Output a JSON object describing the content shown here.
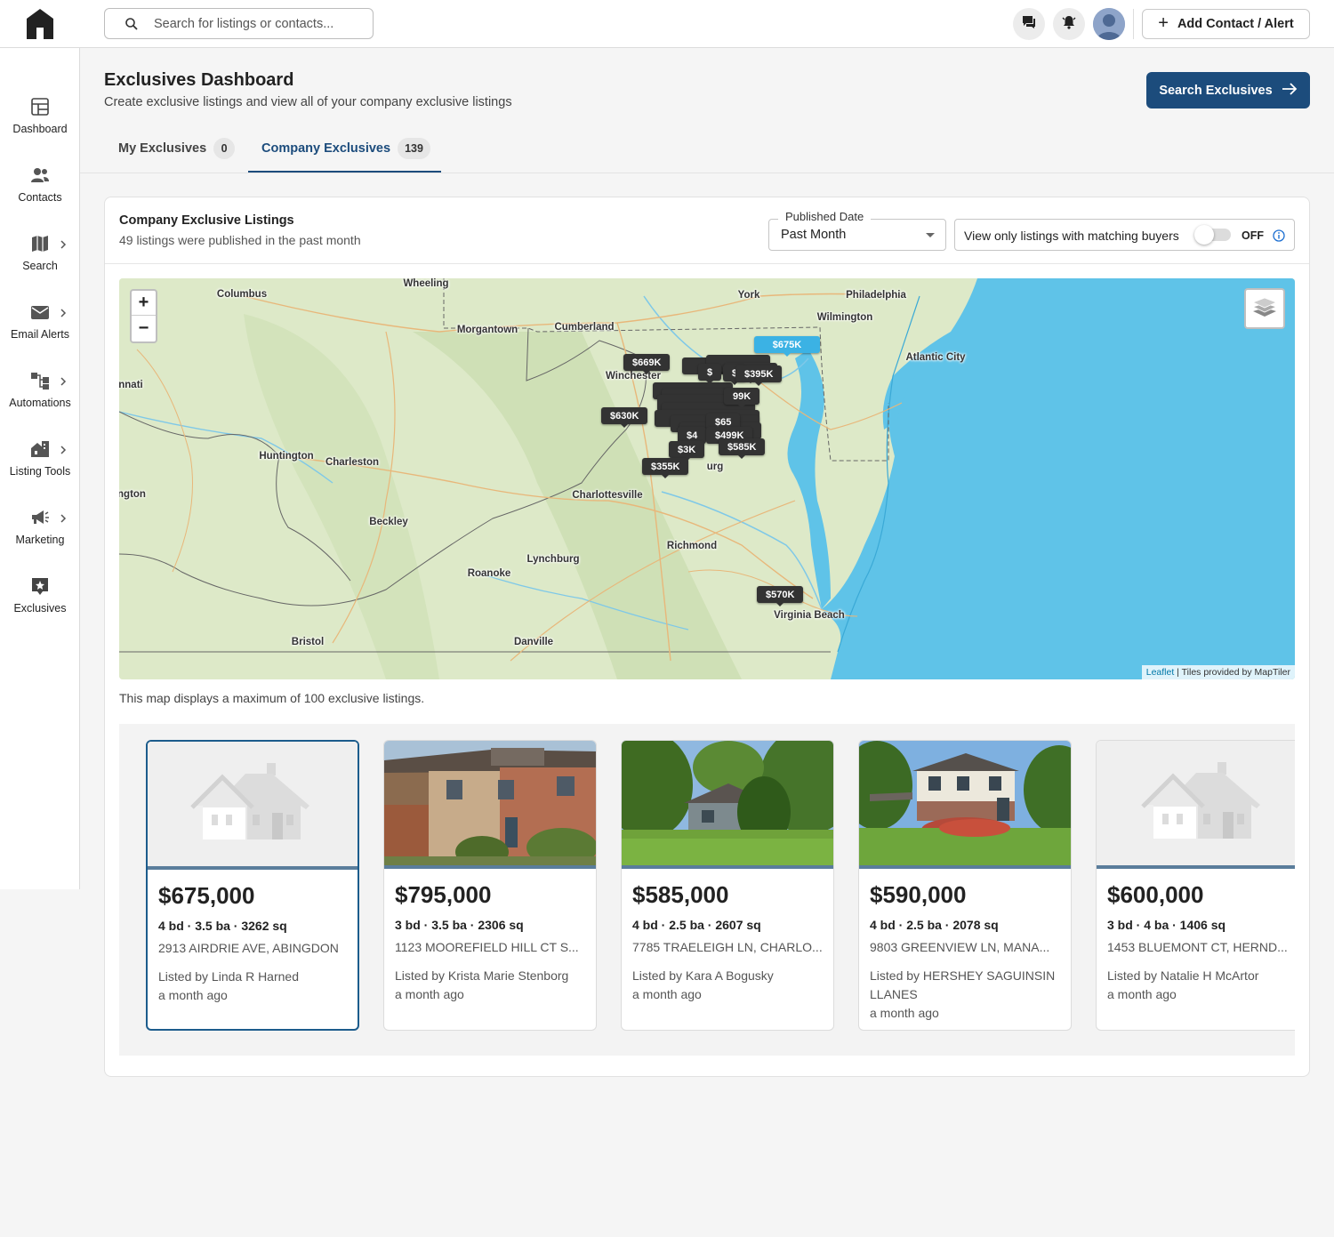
{
  "header": {
    "search_placeholder": "Search for listings or contacts...",
    "add_button": "Add Contact / Alert"
  },
  "sidebar": {
    "items": [
      {
        "label": "Dashboard",
        "icon": "dashboard-icon"
      },
      {
        "label": "Contacts",
        "icon": "contacts-icon"
      },
      {
        "label": "Search",
        "icon": "map-icon"
      },
      {
        "label": "Email Alerts",
        "icon": "mail-icon"
      },
      {
        "label": "Automations",
        "icon": "automations-icon"
      },
      {
        "label": "Listing Tools",
        "icon": "listing-tools-icon"
      },
      {
        "label": "Marketing",
        "icon": "megaphone-icon"
      },
      {
        "label": "Exclusives",
        "icon": "exclusives-icon"
      }
    ]
  },
  "page": {
    "title": "Exclusives Dashboard",
    "subtitle": "Create exclusive listings and view all of your company exclusive listings",
    "search_button": "Search Exclusives"
  },
  "tabs": [
    {
      "label": "My Exclusives",
      "count": "0"
    },
    {
      "label": "Company Exclusives",
      "count": "139"
    }
  ],
  "listings_card": {
    "title": "Company Exclusive Listings",
    "subtitle": "49 listings were published in the past month",
    "filter_label": "Published Date",
    "filter_value": "Past Month",
    "toggle_label": "View only listings with matching buyers",
    "toggle_state": "OFF",
    "map_note": "This map displays a maximum of 100 exclusive listings."
  },
  "map": {
    "zoom_in": "+",
    "zoom_out": "−",
    "attribution_link": "Leaflet",
    "attribution_text": " | Tiles provided by MapTiler",
    "cities": [
      "Columbus",
      "Wheeling",
      "York",
      "Philadelphia",
      "Wilmington",
      "Morgantown",
      "Cumberland",
      "Atlantic City",
      "Winchester",
      "nnati",
      "Huntington",
      "Charleston",
      "Charlottesville",
      "ngton",
      "Beckley",
      "Richmond",
      "Lynchburg",
      "Roanoke",
      "Virginia Beach",
      "Bristol",
      "Danville",
      "urg"
    ],
    "pins": [
      "$675K",
      "$669K",
      "$395K",
      "$",
      "$",
      "99K",
      "$630K",
      "$4",
      "$499K",
      "$585K",
      "$3K",
      "$355K",
      "$570K",
      "$65",
      "$675K"
    ]
  },
  "listings": [
    {
      "price": "$675,000",
      "specs": "4 bd · 3.5 ba · 3262 sq",
      "address": "2913 AIRDRIE AVE, ABINGDON",
      "agent": "Listed by Linda R Harned",
      "age": "a month ago"
    },
    {
      "price": "$795,000",
      "specs": "3 bd · 3.5 ba · 2306 sq",
      "address": "1123 MOOREFIELD HILL CT S...",
      "agent": "Listed by Krista Marie Stenborg",
      "age": "a month ago"
    },
    {
      "price": "$585,000",
      "specs": "4 bd · 2.5 ba · 2607 sq",
      "address": "7785 TRAELEIGH LN, CHARLO...",
      "agent": "Listed by Kara A Bogusky",
      "age": "a month ago"
    },
    {
      "price": "$590,000",
      "specs": "4 bd · 2.5 ba · 2078 sq",
      "address": "9803 GREENVIEW LN, MANA...",
      "agent": "Listed by HERSHEY SAGUINSIN LLANES",
      "age": "a month ago"
    },
    {
      "price": "$600,000",
      "specs": "3 bd · 4 ba · 1406 sq",
      "address": "1453 BLUEMONT CT, HERND...",
      "agent": "Listed by Natalie H McArtor",
      "age": "a month ago"
    }
  ],
  "colors": {
    "brand": "#1c4c7c",
    "active_pin": "#3bb2e4",
    "pin": "#333333",
    "water": "#5fc3e8",
    "land": "#dce8c9"
  }
}
